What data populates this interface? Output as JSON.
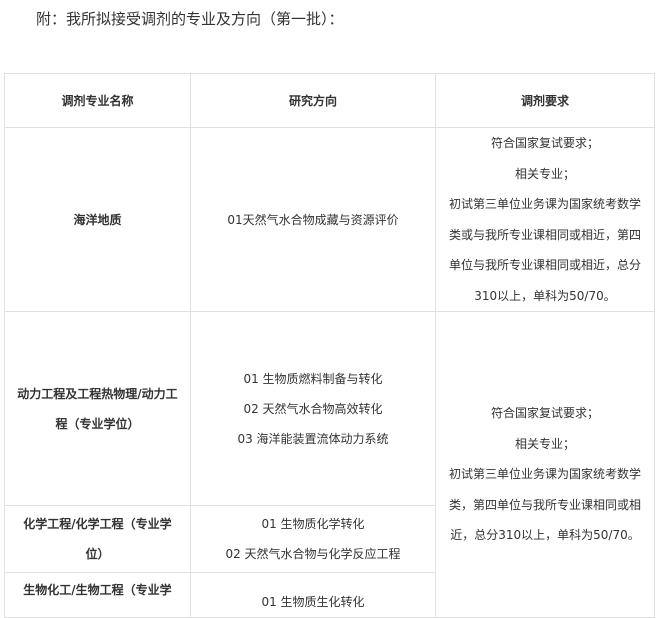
{
  "intro": "附：我所拟接受调剂的专业及方向（第一批）：",
  "table": {
    "headers": [
      "调剂专业名称",
      "研究方向",
      "调剂要求"
    ],
    "rows": [
      {
        "major": "海洋地质",
        "directions": [
          "01天然气水合物成藏与资源评价"
        ],
        "requirements": [
          "符合国家复试要求；",
          "相关专业；",
          "初试第三单位业务课为国家统考数学",
          "类或与我所专业课相同或相近，第四",
          "单位与我所专业课相同或相近，总分",
          "310以上，单科为50/70。"
        ]
      },
      {
        "major_lines": [
          "动力工程及工程热物理/动力工",
          "程（专业学位）"
        ],
        "directions": [
          "01 生物质燃料制备与转化",
          "02 天然气水合物高效转化",
          "03 海洋能装置流体动力系统"
        ]
      },
      {
        "major_lines": [
          "化学工程/化学工程（专业学",
          "位）"
        ],
        "directions": [
          "01 生物质化学转化",
          "02 天然气水合物与化学反应工程"
        ]
      },
      {
        "major_lines": [
          "生物化工/生物工程（专业学"
        ],
        "directions": [
          "01 生物质生化转化"
        ]
      }
    ],
    "shared_requirements": [
      "符合国家复试要求；",
      "相关专业；",
      "初试第三单位业务课为国家统考数学",
      "类，第四单位与我所专业课相同或相",
      "近，总分310以上，单科为50/70。"
    ]
  }
}
